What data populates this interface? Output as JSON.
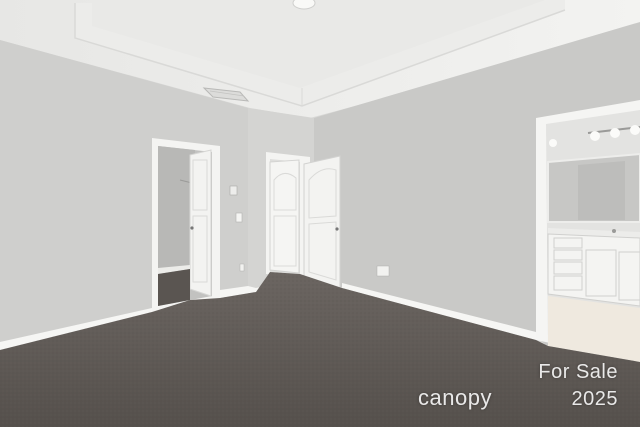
{
  "image": {
    "subject": "empty bedroom with carpet, open doors and ensuite bathroom",
    "colors": {
      "ceiling": "#f1f1ef",
      "wall_left": "#cfcfcd",
      "wall_right": "#c9c9c7",
      "wall_middle": "#d4d4d2",
      "trim": "#f6f6f4",
      "carpet": "#5e5955",
      "bath_floor": "#efe9df",
      "door": "#f3f3f1"
    }
  },
  "watermark": {
    "line1": "For Sale",
    "brand": "canopy",
    "year": "2025"
  }
}
